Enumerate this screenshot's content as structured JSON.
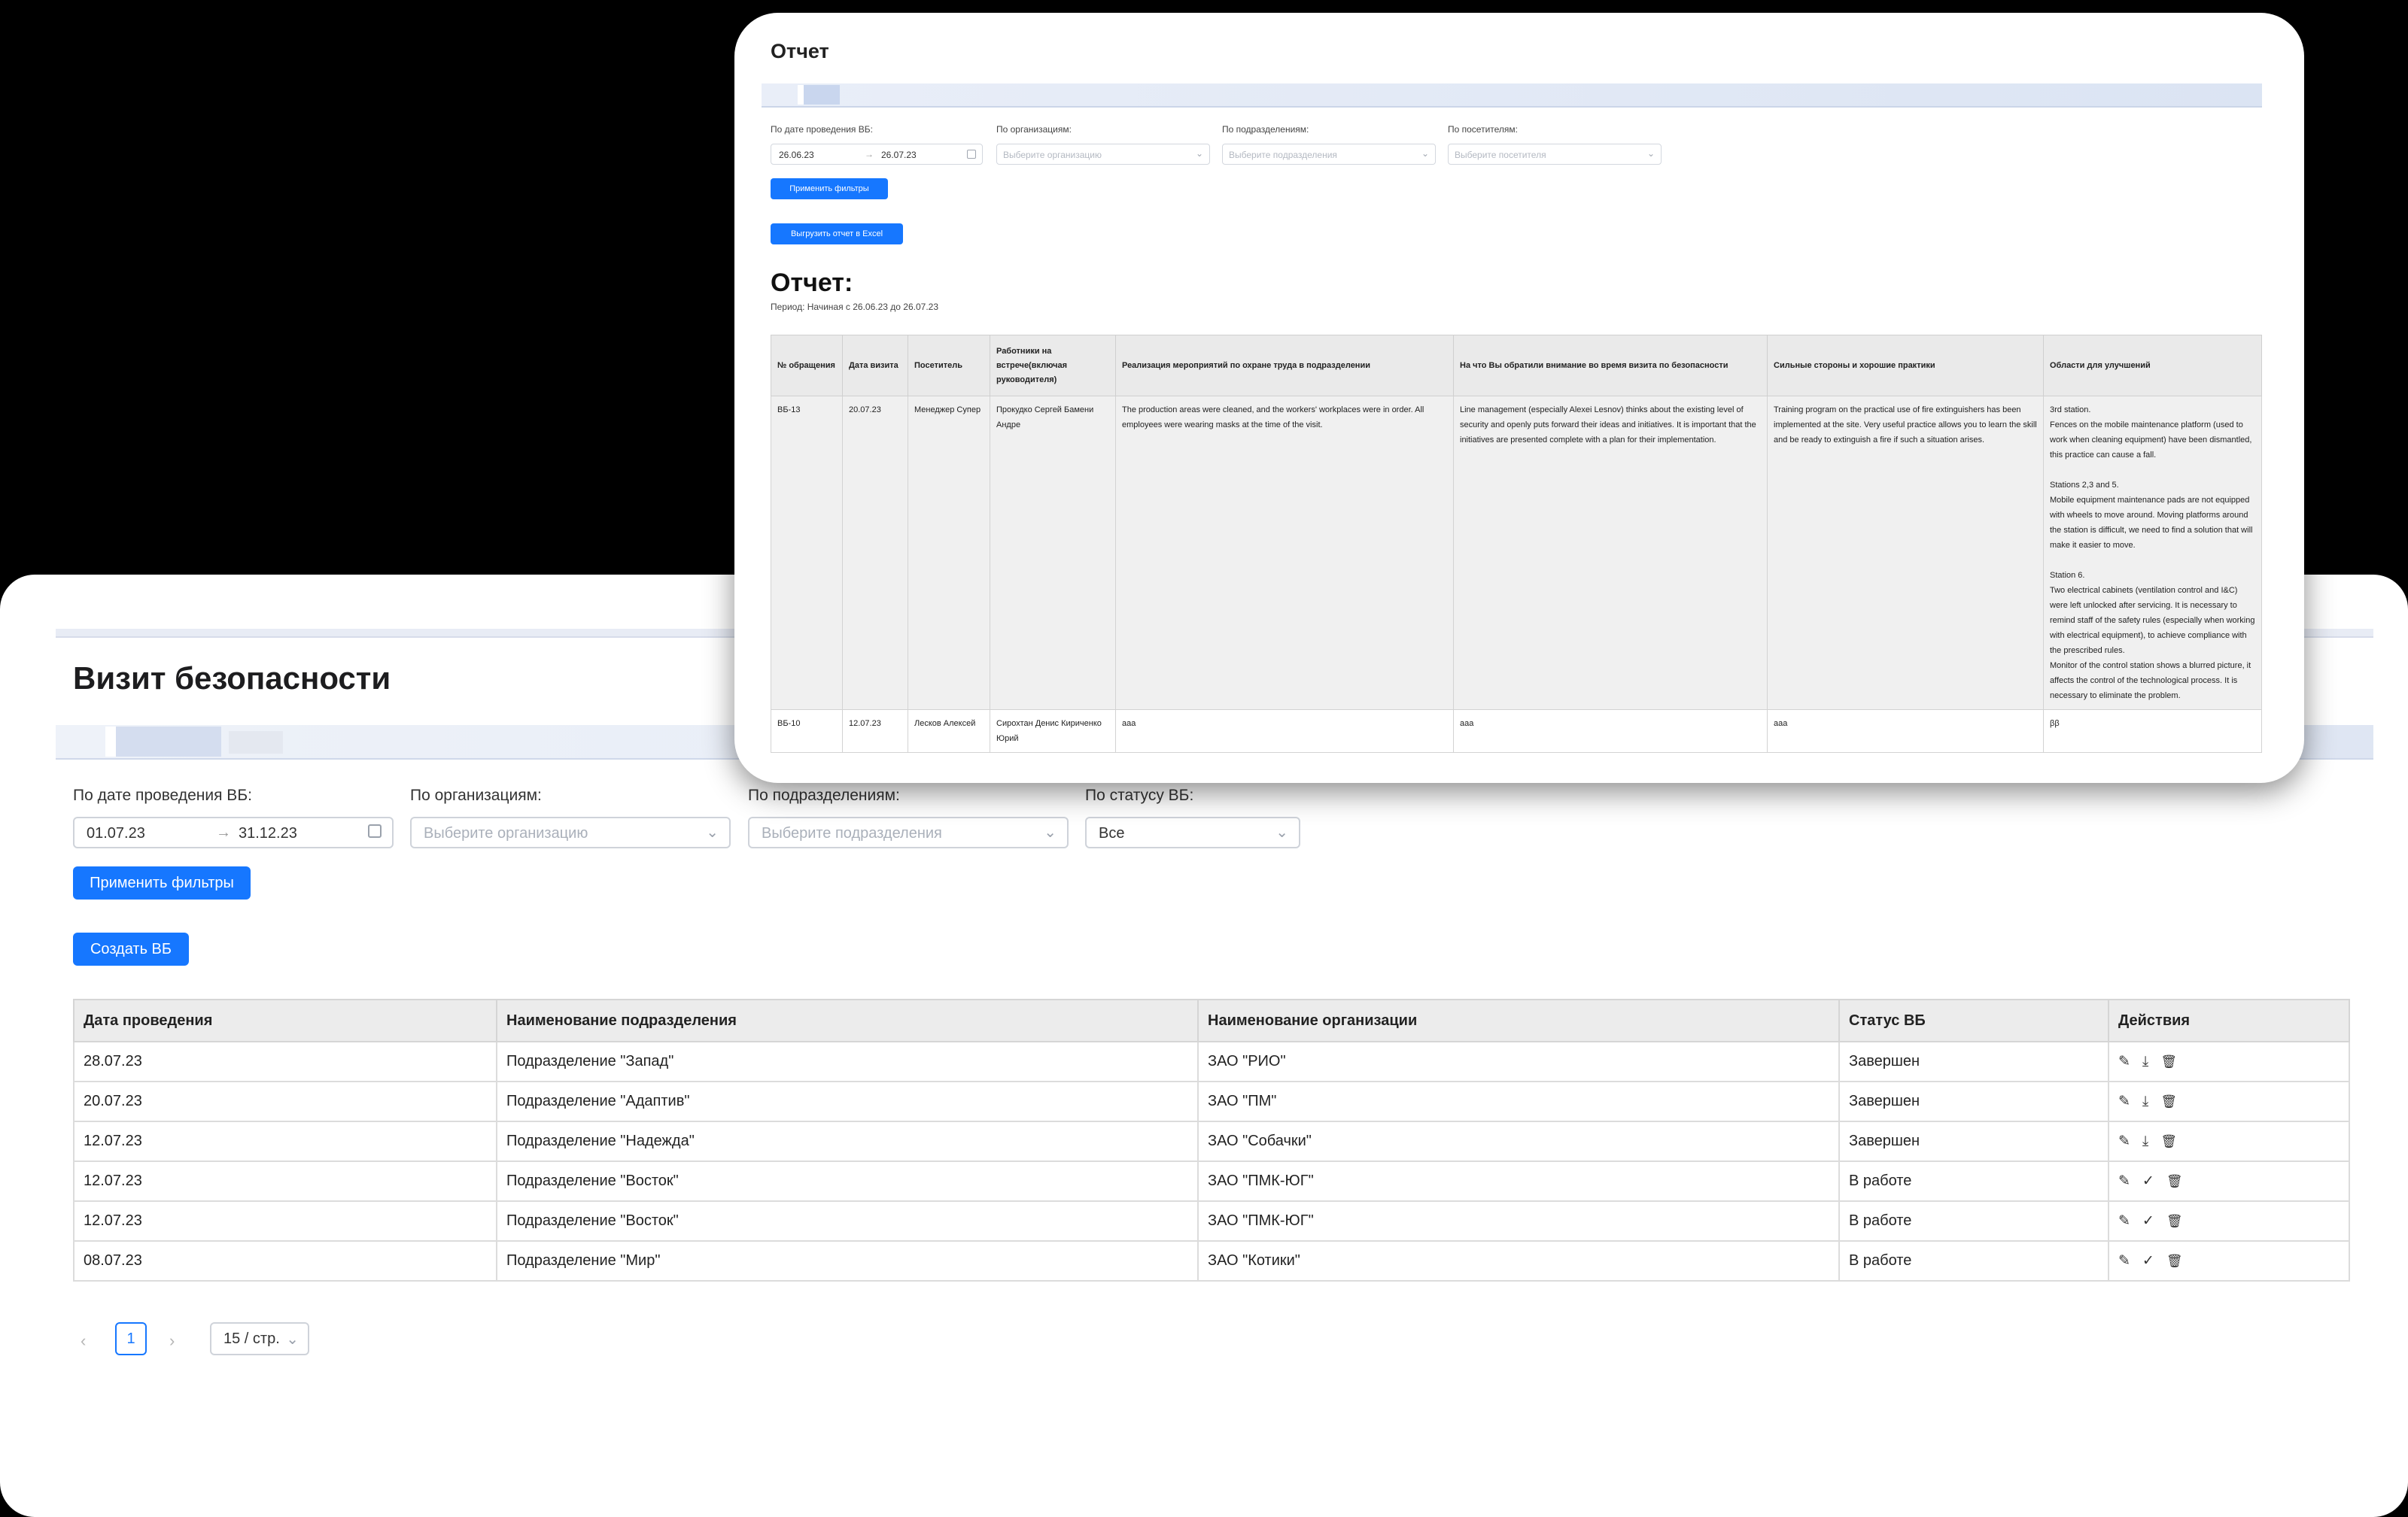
{
  "main": {
    "title": "Визит безопасности",
    "filters": {
      "date_label": "По дате проведения ВБ:",
      "date_from": "01.07.23",
      "date_sep": "→",
      "date_to": "31.12.23",
      "org_label": "По организациям:",
      "org_placeholder": "Выберите организацию",
      "dept_label": "По подразделениям:",
      "dept_placeholder": "Выберите подразделения",
      "status_label": "По статусу ВБ:",
      "status_value": "Все"
    },
    "apply_button": "Применить фильтры",
    "create_button": "Создать ВБ",
    "table": {
      "headers": [
        "Дата проведения",
        "Наименование подразделения",
        "Наименование организации",
        "Статус ВБ",
        "Действия"
      ],
      "rows": [
        {
          "date": "28.07.23",
          "dept": "Подразделение \"Запад\"",
          "org": "ЗАО \"РИО\"",
          "status": "Завершен",
          "mid_icon": "download-icon",
          "mid_glyph": "⤓"
        },
        {
          "date": "20.07.23",
          "dept": "Подразделение \"Адаптив\"",
          "org": "ЗАО \"ПМ\"",
          "status": "Завершен",
          "mid_icon": "download-icon",
          "mid_glyph": "⤓"
        },
        {
          "date": "12.07.23",
          "dept": "Подразделение \"Надежда\"",
          "org": "ЗАО \"Собачки\"",
          "status": "Завершен",
          "mid_icon": "download-icon",
          "mid_glyph": "⤓"
        },
        {
          "date": "12.07.23",
          "dept": "Подразделение \"Восток\"",
          "org": "ЗАО \"ПМК-ЮГ\"",
          "status": "В работе",
          "mid_icon": "check-icon",
          "mid_glyph": "✓"
        },
        {
          "date": "12.07.23",
          "dept": "Подразделение \"Восток\"",
          "org": "ЗАО \"ПМК-ЮГ\"",
          "status": "В работе",
          "mid_icon": "check-icon",
          "mid_glyph": "✓"
        },
        {
          "date": "08.07.23",
          "dept": "Подразделение \"Мир\"",
          "org": "ЗАО \"Котики\"",
          "status": "В работе",
          "mid_icon": "check-icon",
          "mid_glyph": "✓"
        }
      ]
    },
    "pagination": {
      "prev": "‹",
      "current": "1",
      "next": "›",
      "page_size": "15 / стр."
    }
  },
  "report": {
    "title": "Отчет",
    "filters": {
      "date_label": "По дате проведения ВБ:",
      "date_from": "26.06.23",
      "date_sep": "→",
      "date_to": "26.07.23",
      "org_label": "По организациям:",
      "org_placeholder": "Выберите организацию",
      "dept_label": "По подразделениям:",
      "dept_placeholder": "Выберите подразделения",
      "visitor_label": "По посетителям:",
      "visitor_placeholder": "Выберите посетителя"
    },
    "apply_button": "Применить фильтры",
    "export_button": "Выгрузить отчет в Excel",
    "heading": "Отчет:",
    "period": "Период: Начиная с 26.06.23 до 26.07.23",
    "table": {
      "headers": [
        "№ обращения",
        "Дата визита",
        "Посетитель",
        "Работники на встрече(включая руководителя)",
        "Реализация мероприятий по охране труда в подразделении",
        "На что Вы обратили внимание во время визита по безопасности",
        "Сильные стороны и хорошие практики",
        "Области для улучшений"
      ],
      "rows": [
        {
          "num": "ВБ-13",
          "date": "20.07.23",
          "visitor": "Менеджер Супер",
          "workers": "Прокудко Сергей Бамени Андре",
          "measures": "The production areas were cleaned, and the workers' workplaces were in order. All employees were wearing masks at the time of the visit.",
          "attention": "Line management (especially Alexei Lesnov) thinks about the existing level of security and openly puts forward their ideas and initiatives. It is important that the initiatives are presented complete with a plan for their implementation.",
          "strengths": "Training program on the practical use of fire extinguishers has been implemented at the site. Very useful practice allows you to learn the skill and be ready to extinguish a fire if such a situation arises.",
          "improvements": "3rd station.\nFences on the mobile maintenance platform (used to work when cleaning equipment) have been dismantled, this practice can cause a fall.\n\nStations 2,3 and 5.\nMobile equipment maintenance pads are not equipped with wheels to move around.  Moving platforms around the station is difficult, we need to find a solution that will make it easier to move.\n\n Station 6.\n   Two electrical cabinets (ventilation control and I&C) were left unlocked after servicing. It is necessary to remind staff of the safety rules (especially when working with electrical equipment), to achieve compliance with the prescribed rules.\nMonitor of the control station shows a blurred picture, it affects the control of the technological process. It is necessary to eliminate the problem."
        },
        {
          "num": "ВБ-10",
          "date": "12.07.23",
          "visitor": "Лесков Алексей",
          "workers": "Сирохтан Денис Кириченко Юрий",
          "measures": "ааа",
          "attention": "ааа",
          "strengths": "ааа",
          "improvements": "ββ"
        }
      ]
    }
  }
}
